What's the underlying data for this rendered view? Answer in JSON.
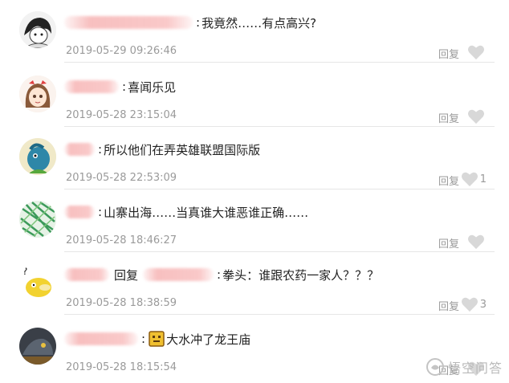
{
  "colors": {
    "timestamp": "#9a9a9a",
    "divider": "#e6e6e6",
    "like_icon": "#d8d8d8",
    "redaction": "#f5aaaa"
  },
  "comments": [
    {
      "avatar_icon": "manga-character-avatar",
      "text": "我竟然……有点高兴?",
      "timestamp": "2019-05-29 09:26:46",
      "reply_label": "回复",
      "likes": ""
    },
    {
      "avatar_icon": "cartoon-girl-avatar",
      "text": "喜闻乐见",
      "timestamp": "2019-05-28 23:15:04",
      "reply_label": "回复",
      "likes": ""
    },
    {
      "avatar_icon": "blue-creature-avatar",
      "text": "所以他们在弄英雄联盟国际版",
      "timestamp": "2019-05-28 22:53:09",
      "reply_label": "回复",
      "likes": "1"
    },
    {
      "avatar_icon": "green-pattern-avatar",
      "text": "山寨出海……当真谁大谁恶谁正确……",
      "timestamp": "2019-05-28 18:46:27",
      "reply_label": "回复",
      "likes": ""
    },
    {
      "avatar_icon": "yellow-duck-avatar",
      "reply_inline": "回复",
      "text": "拳头：谁跟农药一家人？？？",
      "timestamp": "2019-05-28 18:38:59",
      "reply_label": "回复",
      "likes": "3"
    },
    {
      "avatar_icon": "dark-game-avatar",
      "emoji_icon": "gold-face-emoji-icon",
      "text": "大水冲了龙王庙",
      "timestamp": "2019-05-28 18:15:54",
      "reply_label": "回复",
      "likes": ""
    }
  ],
  "watermark": {
    "text": "悟空问答",
    "icon": "wukong-logo-icon"
  }
}
